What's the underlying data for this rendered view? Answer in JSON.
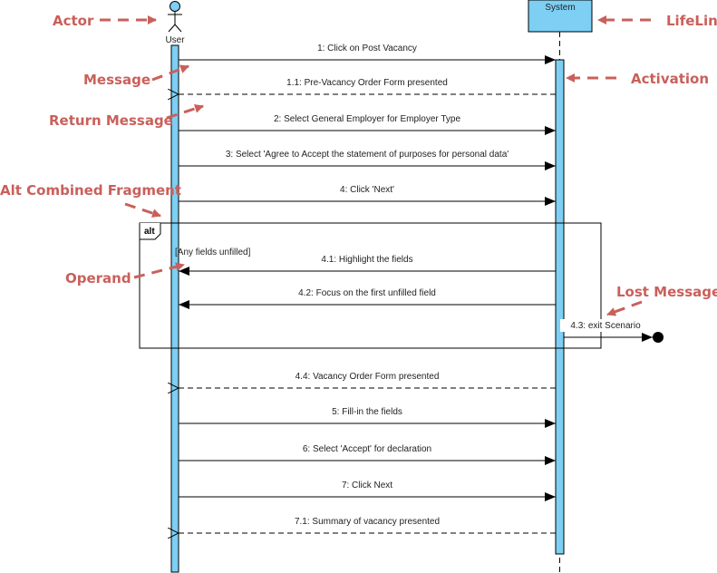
{
  "diagram": {
    "type": "UML Sequence Diagram",
    "colors": {
      "activation_fill": "#7DCFF3",
      "annotation": "#C9605B",
      "line": "#000000"
    },
    "participants": [
      {
        "id": "user",
        "label": "User",
        "kind": "actor"
      },
      {
        "id": "system",
        "label": "System",
        "kind": "lifeline"
      }
    ],
    "fragment": {
      "operator": "alt",
      "guard": "[Any fields unfilled]"
    },
    "messages": [
      {
        "label": "1: Click on Post Vacancy",
        "from": "user",
        "to": "system",
        "kind": "sync"
      },
      {
        "label": "1.1: Pre-Vacancy Order Form presented",
        "from": "system",
        "to": "user",
        "kind": "return"
      },
      {
        "label": "2: Select General Employer for Employer Type",
        "from": "user",
        "to": "system",
        "kind": "sync"
      },
      {
        "label": "3: Select 'Agree to Accept the statement of purposes for personal data'",
        "from": "user",
        "to": "system",
        "kind": "sync"
      },
      {
        "label": "4: Click 'Next'",
        "from": "user",
        "to": "system",
        "kind": "sync"
      },
      {
        "label": "4.1: Highlight the fields",
        "from": "system",
        "to": "user",
        "kind": "sync"
      },
      {
        "label": "4.2: Focus on the first unfilled field",
        "from": "system",
        "to": "user",
        "kind": "sync"
      },
      {
        "label": "4.3: exit Scenario",
        "from": "system",
        "to": "lost",
        "kind": "lost"
      },
      {
        "label": "4.4: Vacancy Order Form presented",
        "from": "system",
        "to": "user",
        "kind": "return"
      },
      {
        "label": "5: Fill-in the fields",
        "from": "user",
        "to": "system",
        "kind": "sync"
      },
      {
        "label": "6: Select 'Accept' for declaration",
        "from": "user",
        "to": "system",
        "kind": "sync"
      },
      {
        "label": "7: Click Next",
        "from": "user",
        "to": "system",
        "kind": "sync"
      },
      {
        "label": "7.1: Summary of vacancy presented",
        "from": "system",
        "to": "user",
        "kind": "return"
      }
    ],
    "annotations": [
      {
        "id": "actor",
        "label": "Actor"
      },
      {
        "id": "lifeline",
        "label": "LifeLine"
      },
      {
        "id": "message",
        "label": "Message"
      },
      {
        "id": "activation",
        "label": "Activation"
      },
      {
        "id": "return-message",
        "label": "Return Message"
      },
      {
        "id": "alt-fragment",
        "label": "Alt Combined Fragment"
      },
      {
        "id": "operand",
        "label": "Operand"
      },
      {
        "id": "lost-message",
        "label": "Lost Message"
      }
    ]
  }
}
